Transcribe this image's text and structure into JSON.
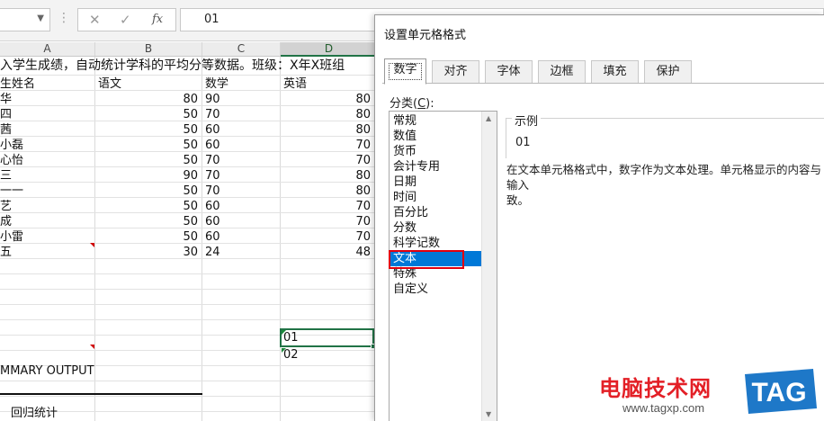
{
  "formula_bar": {
    "name_box": "",
    "dropdown_icon": "chevron-down-icon",
    "separator": "⋮",
    "cancel_icon": "✕",
    "confirm_icon": "✓",
    "fx_label": "fx",
    "content": "01"
  },
  "sheet": {
    "columns": [
      "A",
      "B",
      "C",
      "D"
    ],
    "selected_column": "D",
    "title_row": "入学生成绩，自动统计学科的平均分等数据。班级：X年X班组",
    "headers": {
      "name": "生姓名",
      "chinese": "语文",
      "math": "数学",
      "english": "英语"
    },
    "rows": [
      {
        "name": "华",
        "chinese": "80",
        "math": "90",
        "english": "80"
      },
      {
        "name": "四",
        "chinese": "50",
        "math": "70",
        "english": "80"
      },
      {
        "name": "茜",
        "chinese": "50",
        "math": "60",
        "english": "80"
      },
      {
        "name": "小磊",
        "chinese": "50",
        "math": "60",
        "english": "70"
      },
      {
        "name": "心怡",
        "chinese": "50",
        "math": "70",
        "english": "70"
      },
      {
        "name": "三",
        "chinese": "90",
        "math": "70",
        "english": "80"
      },
      {
        "name": "一一",
        "chinese": "50",
        "math": "70",
        "english": "80"
      },
      {
        "name": "艺",
        "chinese": "50",
        "math": "60",
        "english": "70"
      },
      {
        "name": "成",
        "chinese": "50",
        "math": "60",
        "english": "70"
      },
      {
        "name": "小雷",
        "chinese": "50",
        "math": "60",
        "english": "70"
      },
      {
        "name": "五",
        "chinese": "30",
        "math": "24",
        "english": "48"
      }
    ],
    "selected_cell_value": "01",
    "below_cell_value": "02",
    "summary_output": "MMARY OUTPUT",
    "regression_label": "回归统计"
  },
  "dialog": {
    "title": "设置单元格格式",
    "tabs": [
      "数字",
      "对齐",
      "字体",
      "边框",
      "填充",
      "保护"
    ],
    "active_tab": "数字",
    "category_label": "分类(",
    "category_label_key": "C",
    "category_label_end": "):",
    "categories": [
      "常规",
      "数值",
      "货币",
      "会计专用",
      "日期",
      "时间",
      "百分比",
      "分数",
      "科学记数",
      "文本",
      "特殊",
      "自定义"
    ],
    "selected_category": "文本",
    "sample_label": "示例",
    "sample_value": "01",
    "description_line1": "在文本单元格格式中，数字作为文本处理。单元格显示的内容与输入",
    "description_line2": "致。"
  },
  "watermark": {
    "site_name": "电脑技术网",
    "url": "www.tagxp.com",
    "logo_text": "TAG"
  },
  "colors": {
    "selection_green": "#217346",
    "highlight_red": "#e0000f",
    "list_selection_blue": "#0078d7",
    "logo_blue": "#1e78c8"
  }
}
